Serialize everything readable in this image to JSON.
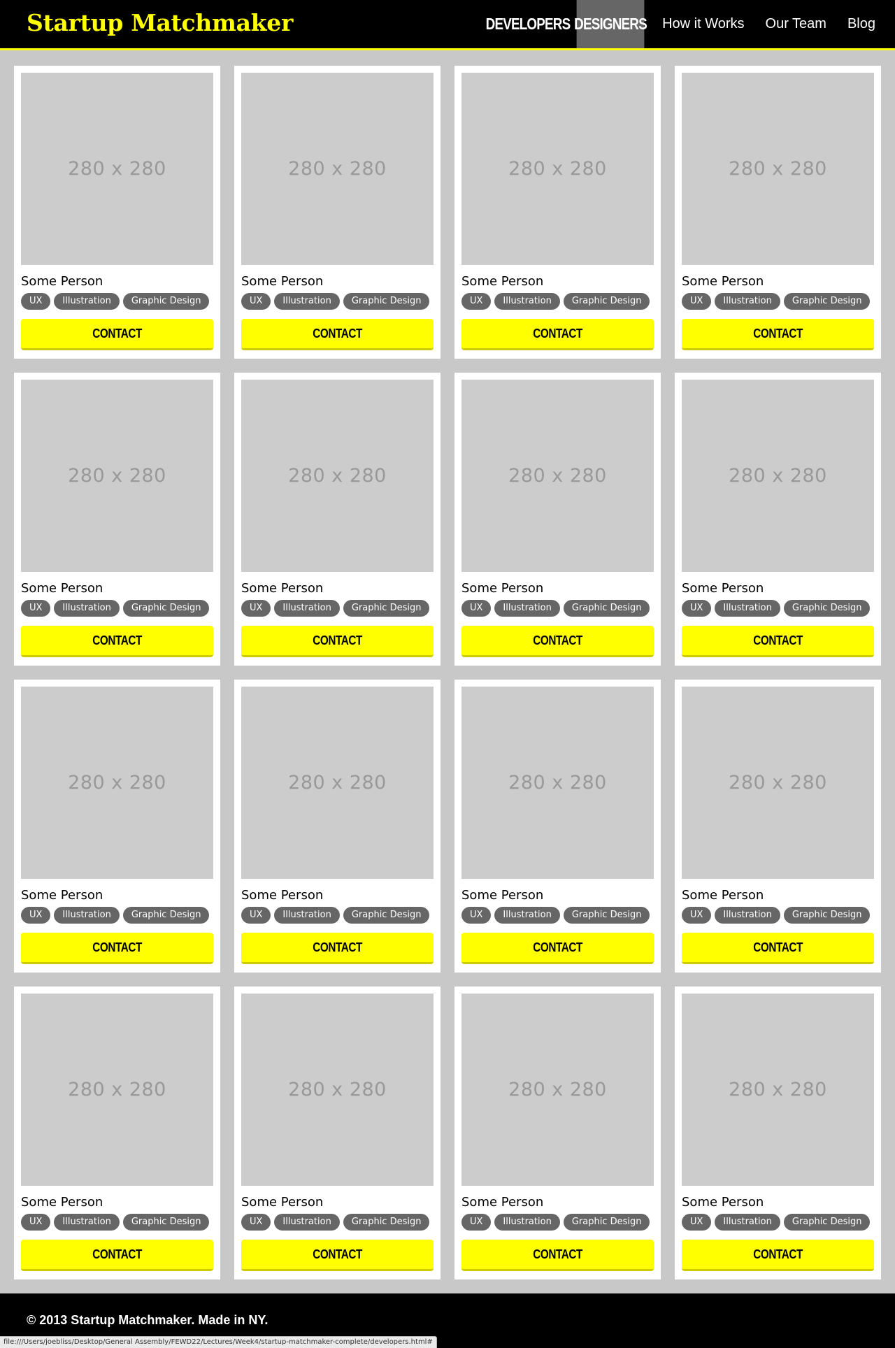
{
  "header": {
    "logo": "Startup Matchmaker",
    "nav": [
      {
        "label": "DEVELOPERS",
        "style": "caps",
        "active": false
      },
      {
        "label": "DESIGNERS",
        "style": "caps",
        "active": true
      },
      {
        "label": "How it Works",
        "style": "plain",
        "active": false
      },
      {
        "label": "Our Team",
        "style": "plain",
        "active": false
      },
      {
        "label": "Blog",
        "style": "plain",
        "active": false
      }
    ]
  },
  "colors": {
    "accent": "#ffff00",
    "header_bg": "#000000",
    "page_bg": "#c8c8c8",
    "tag_bg": "#666666",
    "active_nav_bg": "#666666"
  },
  "cards": [
    {
      "photo": "280 x 280",
      "name": "Some Person",
      "tags": [
        "UX",
        "Illustration",
        "Graphic Design"
      ],
      "button": "CONTACT"
    },
    {
      "photo": "280 x 280",
      "name": "Some Person",
      "tags": [
        "UX",
        "Illustration",
        "Graphic Design"
      ],
      "button": "CONTACT"
    },
    {
      "photo": "280 x 280",
      "name": "Some Person",
      "tags": [
        "UX",
        "Illustration",
        "Graphic Design"
      ],
      "button": "CONTACT"
    },
    {
      "photo": "280 x 280",
      "name": "Some Person",
      "tags": [
        "UX",
        "Illustration",
        "Graphic Design"
      ],
      "button": "CONTACT"
    },
    {
      "photo": "280 x 280",
      "name": "Some Person",
      "tags": [
        "UX",
        "Illustration",
        "Graphic Design"
      ],
      "button": "CONTACT"
    },
    {
      "photo": "280 x 280",
      "name": "Some Person",
      "tags": [
        "UX",
        "Illustration",
        "Graphic Design"
      ],
      "button": "CONTACT"
    },
    {
      "photo": "280 x 280",
      "name": "Some Person",
      "tags": [
        "UX",
        "Illustration",
        "Graphic Design"
      ],
      "button": "CONTACT"
    },
    {
      "photo": "280 x 280",
      "name": "Some Person",
      "tags": [
        "UX",
        "Illustration",
        "Graphic Design"
      ],
      "button": "CONTACT"
    },
    {
      "photo": "280 x 280",
      "name": "Some Person",
      "tags": [
        "UX",
        "Illustration",
        "Graphic Design"
      ],
      "button": "CONTACT"
    },
    {
      "photo": "280 x 280",
      "name": "Some Person",
      "tags": [
        "UX",
        "Illustration",
        "Graphic Design"
      ],
      "button": "CONTACT"
    },
    {
      "photo": "280 x 280",
      "name": "Some Person",
      "tags": [
        "UX",
        "Illustration",
        "Graphic Design"
      ],
      "button": "CONTACT"
    },
    {
      "photo": "280 x 280",
      "name": "Some Person",
      "tags": [
        "UX",
        "Illustration",
        "Graphic Design"
      ],
      "button": "CONTACT"
    },
    {
      "photo": "280 x 280",
      "name": "Some Person",
      "tags": [
        "UX",
        "Illustration",
        "Graphic Design"
      ],
      "button": "CONTACT"
    },
    {
      "photo": "280 x 280",
      "name": "Some Person",
      "tags": [
        "UX",
        "Illustration",
        "Graphic Design"
      ],
      "button": "CONTACT"
    },
    {
      "photo": "280 x 280",
      "name": "Some Person",
      "tags": [
        "UX",
        "Illustration",
        "Graphic Design"
      ],
      "button": "CONTACT"
    },
    {
      "photo": "280 x 280",
      "name": "Some Person",
      "tags": [
        "UX",
        "Illustration",
        "Graphic Design"
      ],
      "button": "CONTACT"
    }
  ],
  "footer": {
    "text": "© 2013 Startup Matchmaker. Made in NY."
  },
  "statusbar": {
    "url": "file:///Users/joebliss/Desktop/General Assembly/FEWD22/Lectures/Week4/startup-matchmaker-complete/developers.html#"
  }
}
